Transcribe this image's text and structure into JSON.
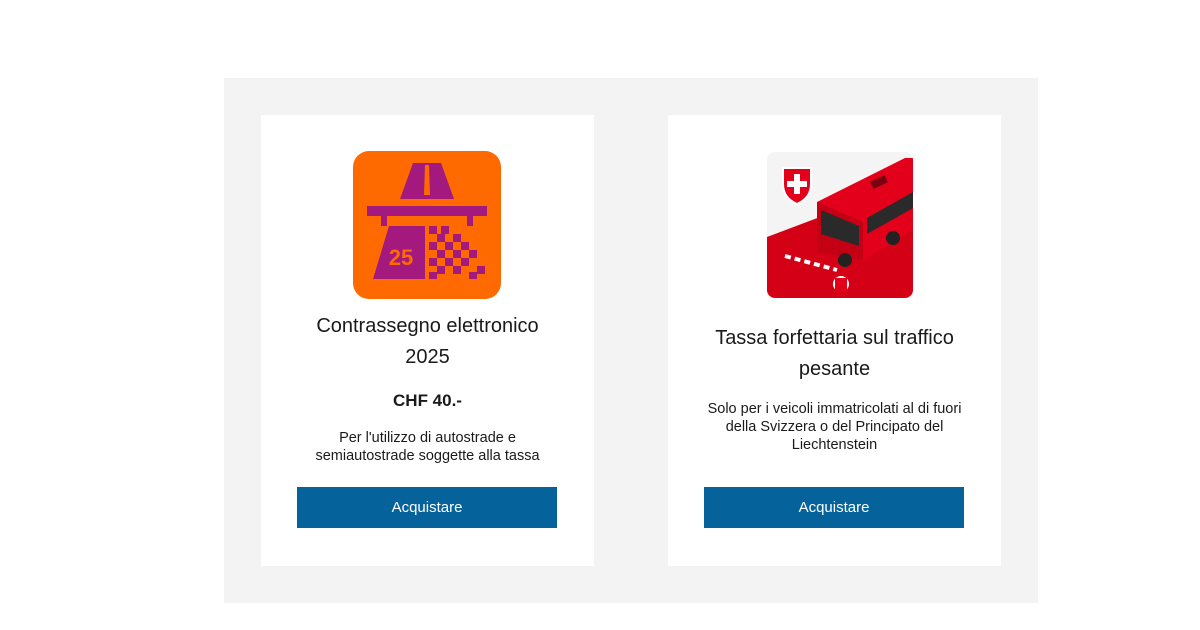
{
  "colors": {
    "panel_bg": "#f3f3f3",
    "card_bg": "#ffffff",
    "button_bg": "#05629a",
    "vignette_orange": "#ff6a00",
    "vignette_purple": "#a3197d",
    "bus_red": "#e3001b"
  },
  "cards": [
    {
      "icon": "e-vignette-2025-icon",
      "title": "Contrassegno elettronico 2025",
      "price": "CHF 40.-",
      "description": "Per l'utilizzo di autostrade e semiautostrade soggette alla tassa",
      "button_label": "Acquistare",
      "icon_text": "25"
    },
    {
      "icon": "heavy-vehicle-bus-icon",
      "title": "Tassa forfettaria sul traffico pesante",
      "description": "Solo per i veicoli immatricolati al di fuori della Svizzera o del Principato del Liechtenstein",
      "button_label": "Acquistare"
    }
  ]
}
